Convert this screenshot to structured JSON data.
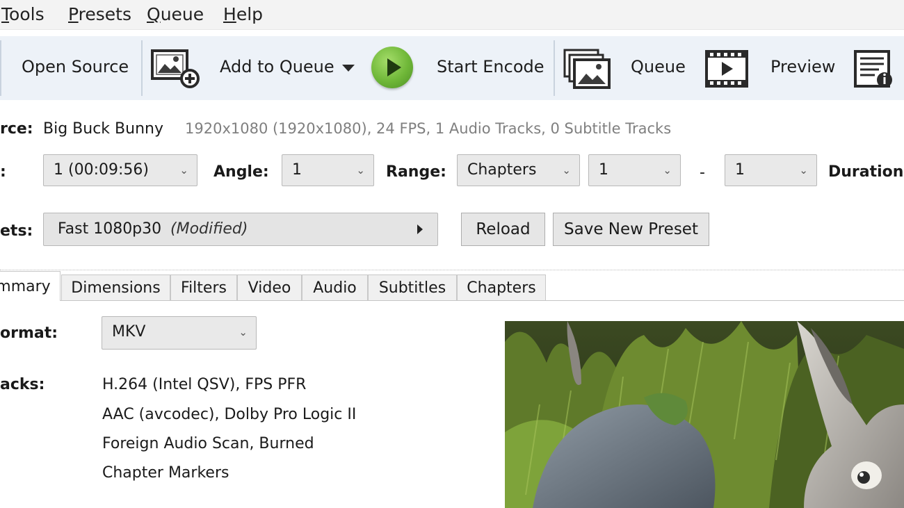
{
  "menu": {
    "items": [
      {
        "first": "T",
        "rest": "ools"
      },
      {
        "first": "P",
        "rest": "resets"
      },
      {
        "first": "Q",
        "rest": "ueue"
      },
      {
        "first": "H",
        "rest": "elp"
      }
    ]
  },
  "toolbar": {
    "open_source": "Open Source",
    "add_to_queue": "Add to Queue",
    "start_encode": "Start Encode",
    "queue": "Queue",
    "preview": "Preview"
  },
  "source": {
    "label": "rce:",
    "name": "Big Buck Bunny",
    "info": "1920x1080 (1920x1080), 24 FPS, 1 Audio Tracks, 0 Subtitle Tracks"
  },
  "title_row": {
    "title_label": ":",
    "title_value": "1 (00:09:56)",
    "angle_label": "Angle:",
    "angle_value": "1",
    "range_label": "Range:",
    "range_value": "Chapters",
    "range_start": "1",
    "range_dash": "-",
    "range_end": "1",
    "duration_label": "Duration:"
  },
  "presets": {
    "label": "ets:",
    "name": "Fast 1080p30",
    "modified": "(Modified)",
    "reload": "Reload",
    "save_new": "Save New Preset"
  },
  "tabs": [
    "mmary",
    "Dimensions",
    "Filters",
    "Video",
    "Audio",
    "Subtitles",
    "Chapters"
  ],
  "summary": {
    "format_label": "ormat:",
    "format_value": "MKV",
    "tracks_label": "acks:",
    "tracks": [
      "H.264 (Intel QSV),  FPS PFR",
      "AAC (avcodec), Dolby Pro Logic II",
      "Foreign Audio Scan, Burned",
      "Chapter Markers"
    ]
  },
  "colors": {
    "toolbar_bg": "#edf2f8",
    "start_encode_green": "#6fb738",
    "menubar_bg": "#f3f3f3"
  },
  "icons": [
    "add-to-queue-icon",
    "start-encode-play-icon",
    "queue-icon",
    "preview-icon",
    "activity-log-icon"
  ]
}
